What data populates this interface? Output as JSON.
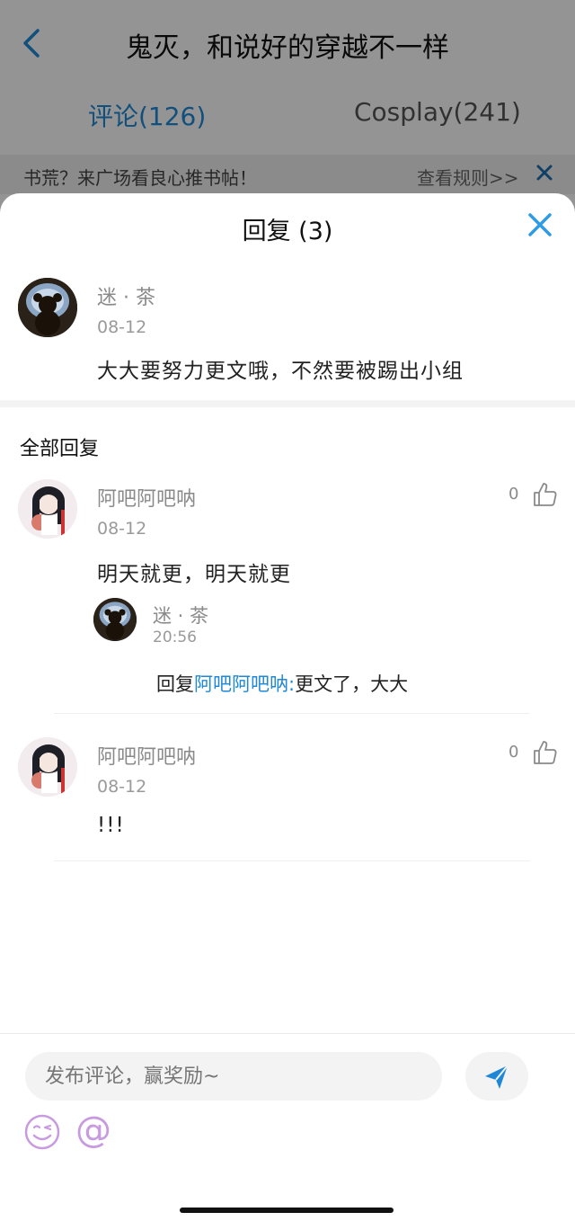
{
  "background": {
    "title": "鬼灭，和说好的穿越不一样",
    "tabs": [
      {
        "label": "评论(126)"
      },
      {
        "label": "Cosplay(241)"
      }
    ],
    "notice": "书荒？来广场看良心推书帖！",
    "notice_link": "查看规则>>"
  },
  "sheet": {
    "title": "回复 (3)",
    "original": {
      "name": "迷 · 茶",
      "date": "08-12",
      "text": "大大要努力更文哦，不然要被踢出小组"
    },
    "all_label": "全部回复",
    "replies": [
      {
        "name": "阿吧阿吧呐",
        "date": "08-12",
        "text": "明天就更，明天就更",
        "likes": "0",
        "sub": {
          "name": "迷 · 茶",
          "time": "20:56",
          "prefix": "回复",
          "mention": "阿吧阿吧呐:",
          "text": "更文了，大大"
        }
      },
      {
        "name": "阿吧阿吧呐",
        "date": "08-12",
        "text": "!!!",
        "likes": "0"
      }
    ]
  },
  "composer": {
    "placeholder": "发布评论，赢奖励~"
  },
  "colors": {
    "accent": "#1e88d6",
    "mention": "#1e88d6",
    "emoji": "#c89be0"
  }
}
